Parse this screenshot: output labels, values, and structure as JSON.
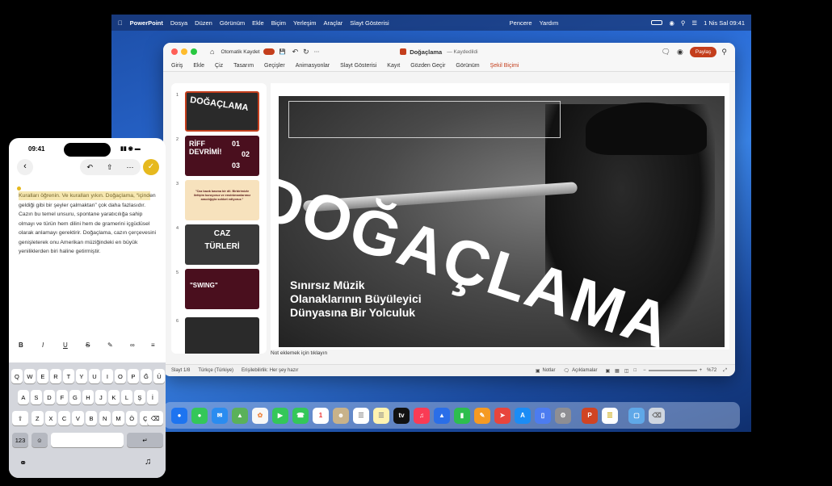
{
  "menubar": {
    "app": "PowerPoint",
    "items": [
      "Dosya",
      "Düzen",
      "Görünüm",
      "Ekle",
      "Biçim",
      "Yerleşim",
      "Araçlar",
      "Slayt Gösterisi"
    ],
    "right_items": [
      "Pencere",
      "Yardım"
    ],
    "datetime": "1 Nis Sal 09:41"
  },
  "window": {
    "autosave": "Otomatik Kaydet",
    "doc_title": "Doğaçlama",
    "saved": "— Kaydedildi",
    "share": "Paylaş",
    "tabs": [
      "Giriş",
      "Ekle",
      "Çiz",
      "Tasarım",
      "Geçişler",
      "Animasyonlar",
      "Slayt Gösterisi",
      "Kayıt",
      "Gözden Geçir",
      "Görünüm"
    ],
    "active_tab": "Şekil Biçimi"
  },
  "thumbnails": [
    {
      "n": "1",
      "text": "DOĞAÇLAMA",
      "bg": "#2a2a2a"
    },
    {
      "n": "2",
      "text": "RİFF DEVRİMİ!",
      "nums": [
        "01",
        "02",
        "03"
      ],
      "bg": "#4a0f1e"
    },
    {
      "n": "3",
      "text": "\"Caz bazık basma bir dil. Birbirimizle iletişim kuruyoruz ve enstrümanlarımız aracılığıyla sohbet ediyoruz.\"",
      "bg": "#f7e2bd"
    },
    {
      "n": "4",
      "text": "CAZ TÜRLERİ",
      "bg": "#3a3a3a"
    },
    {
      "n": "5",
      "text": "\"SWING\"",
      "bg": "#4a0f1e"
    },
    {
      "n": "6",
      "text": "",
      "bg": "#2a2a2a"
    }
  ],
  "slide": {
    "title": "DOĞAÇLAMA",
    "subtitle": [
      "Sınırsız Müzik",
      "Olanaklarının Büyüleyici",
      "Dünyasına Bir Yolculuk"
    ]
  },
  "notes": "Not eklemek için tıklayın",
  "status": {
    "slide": "Slayt 1/8",
    "lang": "Türkçe (Türkiye)",
    "access": "Erişilebilirlik: Her şey hazır",
    "notes": "Notlar",
    "comments": "Açıklamalar",
    "zoom": "%72"
  },
  "phone": {
    "time": "09:41",
    "doc_text": "Kuralları öğrenin. Ve kuralları yıkın. Doğaçlama, “içinden geldiği gibi bir şeyler çalmaktan” çok daha fazlasıdır. Cazın bu temel unsuru, spontane yaratıcılığa sahip olmayı ve türün hem dilini hem de gramerini içgüdüsel olarak anlamayı gerektirir. Doğaçlama, cazın çerçevesini genişleterek onu Amerikan müziğindeki en büyük yeniliklerden biri haline getirmiştir.",
    "format": [
      "B",
      "I",
      "U",
      "S"
    ],
    "row1": [
      "Q",
      "W",
      "E",
      "R",
      "T",
      "Y",
      "U",
      "I",
      "O",
      "P",
      "Ğ",
      "Ü"
    ],
    "row2": [
      "A",
      "S",
      "D",
      "F",
      "G",
      "H",
      "J",
      "K",
      "L",
      "Ş",
      "İ"
    ],
    "row3": [
      "Z",
      "X",
      "C",
      "V",
      "B",
      "N",
      "M",
      "Ö",
      "Ç"
    ],
    "num_key": "123"
  },
  "colors": {
    "accent": "#c43e1c",
    "slide_text": "#ffffff",
    "gold": "#e6b91e"
  }
}
